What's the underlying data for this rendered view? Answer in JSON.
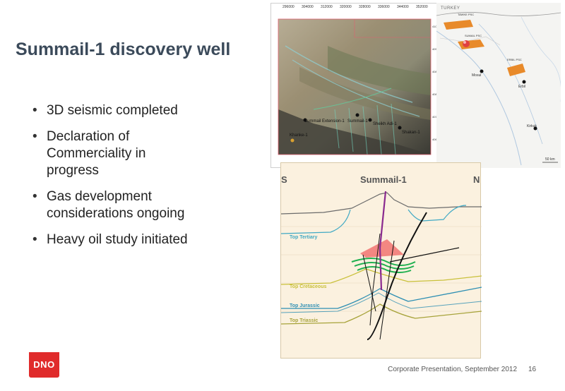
{
  "slide": {
    "title": "Summail-1 discovery well",
    "bullets": [
      "3D seismic completed",
      "Declaration of Commerciality in progress",
      "Gas development considerations ongoing",
      "Heavy oil study initiated"
    ]
  },
  "satellite_map": {
    "top_ticks": [
      "296000",
      "304000",
      "312000",
      "320000",
      "328000",
      "336000",
      "344000",
      "352000"
    ],
    "right_ticks": [
      "4104000",
      "4096000",
      "4088000",
      "4080000",
      "4072000",
      "4064000"
    ],
    "wells": [
      "Summail Extension-1",
      "Summail-1",
      "Sheikh Adi-1",
      "Shakan-1",
      "Khanke-1"
    ]
  },
  "location_map": {
    "country": "TURKEY",
    "blocks": [
      "TAWKE PSC",
      "SUMAIL PSC",
      "ERBIL PSC"
    ],
    "cities": [
      "Mosul",
      "Erbil",
      "Kirkuk"
    ],
    "scale": "50 km"
  },
  "cross_section": {
    "well": "Summail-1",
    "south": "S",
    "north": "N",
    "horizons": [
      "Top Tertiary",
      "Top Cretaceous",
      "Top Jurassic",
      "Top Triassic"
    ]
  },
  "footer": {
    "logo": "DNO",
    "text": "Corporate Presentation, September 2012",
    "page": "16"
  },
  "colors": {
    "title": "#3b4a5a",
    "logo": "#e02b2b",
    "tertiary": "#40a9c4",
    "cretaceous": "#c9c03a",
    "jurassic": "#2e8fb3",
    "triassic": "#a7a33a",
    "gas_cap": "#ef5a5a",
    "well_path": "#8a2a8f"
  }
}
